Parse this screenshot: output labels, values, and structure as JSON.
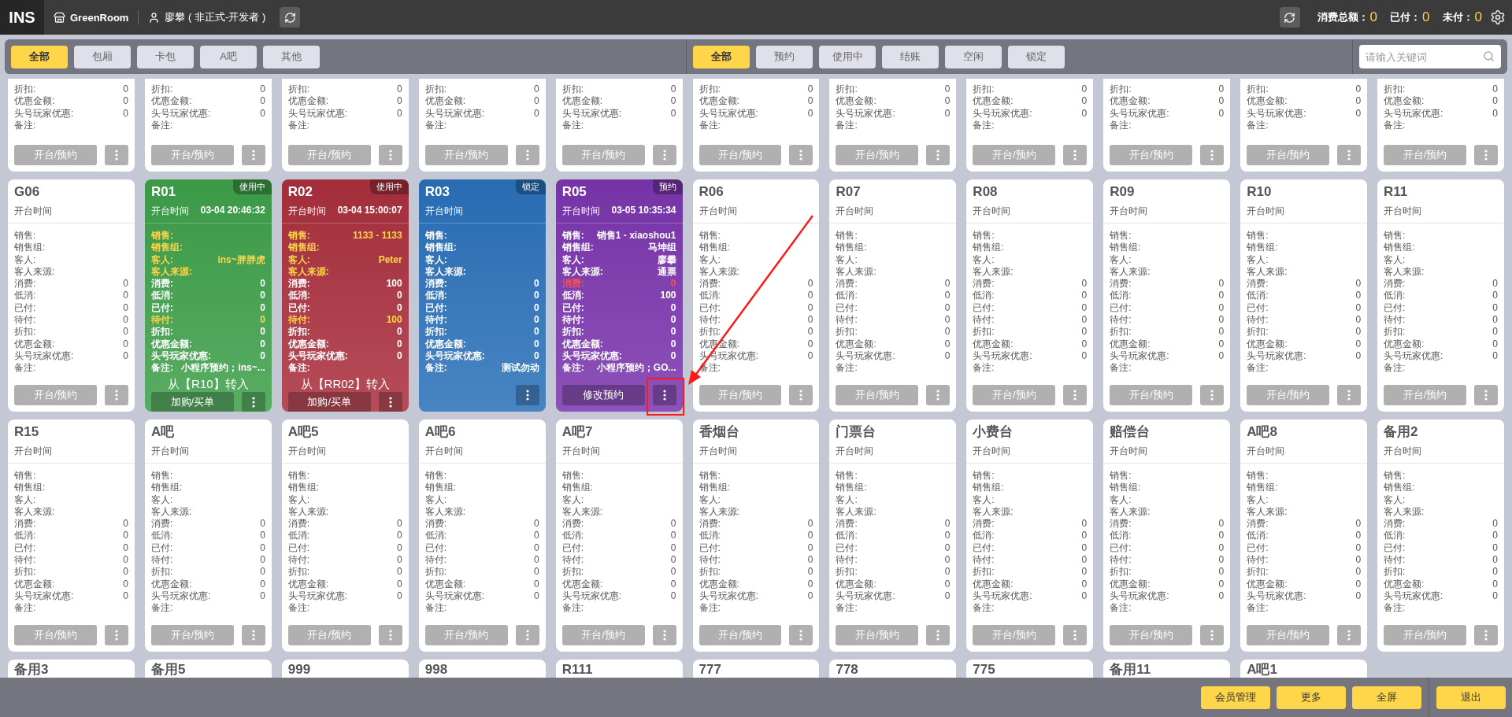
{
  "header": {
    "logo": "INS",
    "store": "GreenRoom",
    "user": "廖攀 ( 非正式-开发者 )",
    "stats": [
      {
        "label": "消费总额：",
        "value": "0"
      },
      {
        "label": "已付：",
        "value": "0"
      },
      {
        "label": "未付：",
        "value": "0"
      }
    ]
  },
  "area_tabs": [
    {
      "label": "全部",
      "selected": true
    },
    {
      "label": "包厢",
      "selected": false
    },
    {
      "label": "卡包",
      "selected": false
    },
    {
      "label": "A吧",
      "selected": false
    },
    {
      "label": "其他",
      "selected": false
    }
  ],
  "status_tabs": [
    {
      "label": "全部",
      "selected": true
    },
    {
      "label": "预约",
      "selected": false
    },
    {
      "label": "使用中",
      "selected": false
    },
    {
      "label": "结账",
      "selected": false
    },
    {
      "label": "空闲",
      "selected": false
    },
    {
      "label": "锁定",
      "selected": false
    }
  ],
  "search": {
    "placeholder": "请输入关键词"
  },
  "cards": [
    {
      "fields": [
        {
          "label": "折扣:",
          "value": "0"
        },
        {
          "label": "优惠金额:",
          "value": "0"
        },
        {
          "label": "头号玩家优惠:",
          "value": "0"
        },
        {
          "label": "备注:"
        }
      ],
      "button": "开台/预约"
    },
    {
      "fields": [
        {
          "label": "折扣:",
          "value": "0"
        },
        {
          "label": "优惠金额:",
          "value": "0"
        },
        {
          "label": "头号玩家优惠:",
          "value": "0"
        },
        {
          "label": "备注:"
        }
      ],
      "button": "开台/预约"
    },
    {
      "fields": [
        {
          "label": "折扣:",
          "value": "0"
        },
        {
          "label": "优惠金额:",
          "value": "0"
        },
        {
          "label": "头号玩家优惠:",
          "value": "0"
        },
        {
          "label": "备注:"
        }
      ],
      "button": "开台/预约"
    },
    {
      "fields": [
        {
          "label": "折扣:",
          "value": "0"
        },
        {
          "label": "优惠金额:",
          "value": "0"
        },
        {
          "label": "头号玩家优惠:",
          "value": "0"
        },
        {
          "label": "备注:"
        }
      ],
      "button": "开台/预约"
    },
    {
      "fields": [
        {
          "label": "折扣:",
          "value": "0"
        },
        {
          "label": "优惠金额:",
          "value": "0"
        },
        {
          "label": "头号玩家优惠:",
          "value": "0"
        },
        {
          "label": "备注:"
        }
      ],
      "button": "开台/预约"
    },
    {
      "fields": [
        {
          "label": "折扣:",
          "value": "0"
        },
        {
          "label": "优惠金额:",
          "value": "0"
        },
        {
          "label": "头号玩家优惠:",
          "value": "0"
        },
        {
          "label": "备注:"
        }
      ],
      "button": "开台/预约"
    },
    {
      "fields": [
        {
          "label": "折扣:",
          "value": "0"
        },
        {
          "label": "优惠金额:",
          "value": "0"
        },
        {
          "label": "头号玩家优惠:",
          "value": "0"
        },
        {
          "label": "备注:"
        }
      ],
      "button": "开台/预约"
    },
    {
      "fields": [
        {
          "label": "折扣:",
          "value": "0"
        },
        {
          "label": "优惠金额:",
          "value": "0"
        },
        {
          "label": "头号玩家优惠:",
          "value": "0"
        },
        {
          "label": "备注:"
        }
      ],
      "button": "开台/预约"
    },
    {
      "fields": [
        {
          "label": "折扣:",
          "value": "0"
        },
        {
          "label": "优惠金额:",
          "value": "0"
        },
        {
          "label": "头号玩家优惠:",
          "value": "0"
        },
        {
          "label": "备注:"
        }
      ],
      "button": "开台/预约"
    },
    {
      "fields": [
        {
          "label": "折扣:",
          "value": "0"
        },
        {
          "label": "优惠金额:",
          "value": "0"
        },
        {
          "label": "头号玩家优惠:",
          "value": "0"
        },
        {
          "label": "备注:"
        }
      ],
      "button": "开台/预约"
    },
    {
      "fields": [
        {
          "label": "折扣:",
          "value": "0"
        },
        {
          "label": "优惠金额:",
          "value": "0"
        },
        {
          "label": "头号玩家优惠:",
          "value": "0"
        },
        {
          "label": "备注:"
        }
      ],
      "button": "开台/预约"
    },
    {
      "title": "G06",
      "open_label": "开台时间",
      "fields": [
        {
          "label": "销售:"
        },
        {
          "label": "销售组:"
        },
        {
          "label": "客人:"
        },
        {
          "label": "客人来源:"
        },
        {
          "label": "消费:",
          "value": "0"
        },
        {
          "label": "低消:",
          "value": "0"
        },
        {
          "label": "已付:",
          "value": "0"
        },
        {
          "label": "待付:",
          "value": "0"
        },
        {
          "label": "折扣:",
          "value": "0"
        },
        {
          "label": "优惠金额:",
          "value": "0"
        },
        {
          "label": "头号玩家优惠:",
          "value": "0"
        },
        {
          "label": "备注:"
        }
      ],
      "button": "开台/预约"
    },
    {
      "title": "R01",
      "status": "使用中",
      "color": "#3d9f49",
      "open_label": "开台时间",
      "open_time": "03-04 20:46:32",
      "fields": [
        {
          "label": "销售:",
          "color": "#ffd54a"
        },
        {
          "label": "销售组:",
          "color": "#ffd54a"
        },
        {
          "label": "客人:",
          "value": "ins~胖胖虎",
          "color": "#ffd54a"
        },
        {
          "label": "客人来源:",
          "color": "#ffd54a"
        },
        {
          "label": "消费:",
          "value": "0"
        },
        {
          "label": "低消:",
          "value": "0"
        },
        {
          "label": "已付:",
          "value": "0"
        },
        {
          "label": "待付:",
          "value": "0",
          "color": "#ffd54a"
        },
        {
          "label": "折扣:",
          "value": "0"
        },
        {
          "label": "优惠金额:",
          "value": "0"
        },
        {
          "label": "头号玩家优惠:",
          "value": "0"
        },
        {
          "label": "备注:",
          "value": "小程序预约；ins~..."
        }
      ],
      "note": "从【R10】转入",
      "button": "加购/买单"
    },
    {
      "title": "R02",
      "status": "使用中",
      "color": "#a92f3d",
      "open_label": "开台时间",
      "open_time": "03-04 15:00:07",
      "fields": [
        {
          "label": "销售:",
          "value": "1133 - 1133",
          "color": "#ffd54a"
        },
        {
          "label": "销售组:",
          "color": "#ffd54a"
        },
        {
          "label": "客人:",
          "value": "Peter",
          "color": "#ffd54a"
        },
        {
          "label": "客人来源:",
          "color": "#ffd54a"
        },
        {
          "label": "消费:",
          "value": "100"
        },
        {
          "label": "低消:",
          "value": "0"
        },
        {
          "label": "已付:",
          "value": "0"
        },
        {
          "label": "待付:",
          "value": "100",
          "color": "#ffd54a"
        },
        {
          "label": "折扣:",
          "value": "0"
        },
        {
          "label": "优惠金额:",
          "value": "0"
        },
        {
          "label": "头号玩家优惠:",
          "value": "0"
        },
        {
          "label": "备注:"
        }
      ],
      "note": "从【RR02】转入",
      "button": "加购/买单"
    },
    {
      "title": "R03",
      "status": "锁定",
      "color": "#2a70b9",
      "open_label": "开台时间",
      "fields": [
        {
          "label": "销售:"
        },
        {
          "label": "销售组:"
        },
        {
          "label": "客人:"
        },
        {
          "label": "客人来源:"
        },
        {
          "label": "消费:",
          "value": "0"
        },
        {
          "label": "低消:",
          "value": "0"
        },
        {
          "label": "已付:",
          "value": "0"
        },
        {
          "label": "待付:",
          "value": "0"
        },
        {
          "label": "折扣:",
          "value": "0"
        },
        {
          "label": "优惠金额:",
          "value": "0"
        },
        {
          "label": "头号玩家优惠:",
          "value": "0"
        },
        {
          "label": "备注:",
          "value": "测试勿动"
        }
      ]
    },
    {
      "title": "R05",
      "status": "预约",
      "color": "#7a35ad",
      "open_label": "开台时间",
      "open_time": "03-05 10:35:34",
      "fields": [
        {
          "label": "销售:",
          "value": "销售1 - xiaoshou1"
        },
        {
          "label": "销售组:",
          "value": "马坤组"
        },
        {
          "label": "客人:",
          "value": "廖攀"
        },
        {
          "label": "客人来源:",
          "value": "通票"
        },
        {
          "label": "消费:",
          "value": "0",
          "color": "#ff4d4f"
        },
        {
          "label": "低消:",
          "value": "100"
        },
        {
          "label": "已付:",
          "value": "0"
        },
        {
          "label": "待付:",
          "value": "0"
        },
        {
          "label": "折扣:",
          "value": "0"
        },
        {
          "label": "优惠金额:",
          "value": "0"
        },
        {
          "label": "头号玩家优惠:",
          "value": "0"
        },
        {
          "label": "备注:",
          "value": "小程序预约；GO..."
        }
      ],
      "button": "修改预约"
    },
    {
      "title": "R06",
      "open_label": "开台时间",
      "fields": [
        {
          "label": "销售:"
        },
        {
          "label": "销售组:"
        },
        {
          "label": "客人:"
        },
        {
          "label": "客人来源:"
        },
        {
          "label": "消费:",
          "value": "0"
        },
        {
          "label": "低消:",
          "value": "0"
        },
        {
          "label": "已付:",
          "value": "0"
        },
        {
          "label": "待付:",
          "value": "0"
        },
        {
          "label": "折扣:",
          "value": "0"
        },
        {
          "label": "优惠金额:",
          "value": "0"
        },
        {
          "label": "头号玩家优惠:",
          "value": "0"
        },
        {
          "label": "备注:"
        }
      ],
      "button": "开台/预约"
    },
    {
      "title": "R07",
      "open_label": "开台时间",
      "fields": [
        {
          "label": "销售:"
        },
        {
          "label": "销售组:"
        },
        {
          "label": "客人:"
        },
        {
          "label": "客人来源:"
        },
        {
          "label": "消费:",
          "value": "0"
        },
        {
          "label": "低消:",
          "value": "0"
        },
        {
          "label": "已付:",
          "value": "0"
        },
        {
          "label": "待付:",
          "value": "0"
        },
        {
          "label": "折扣:",
          "value": "0"
        },
        {
          "label": "优惠金额:",
          "value": "0"
        },
        {
          "label": "头号玩家优惠:",
          "value": "0"
        },
        {
          "label": "备注:"
        }
      ],
      "button": "开台/预约"
    },
    {
      "title": "R08",
      "open_label": "开台时间",
      "fields": [
        {
          "label": "销售:"
        },
        {
          "label": "销售组:"
        },
        {
          "label": "客人:"
        },
        {
          "label": "客人来源:"
        },
        {
          "label": "消费:",
          "value": "0"
        },
        {
          "label": "低消:",
          "value": "0"
        },
        {
          "label": "已付:",
          "value": "0"
        },
        {
          "label": "待付:",
          "value": "0"
        },
        {
          "label": "折扣:",
          "value": "0"
        },
        {
          "label": "优惠金额:",
          "value": "0"
        },
        {
          "label": "头号玩家优惠:",
          "value": "0"
        },
        {
          "label": "备注:"
        }
      ],
      "button": "开台/预约"
    },
    {
      "title": "R09",
      "open_label": "开台时间",
      "fields": [
        {
          "label": "销售:"
        },
        {
          "label": "销售组:"
        },
        {
          "label": "客人:"
        },
        {
          "label": "客人来源:"
        },
        {
          "label": "消费:",
          "value": "0"
        },
        {
          "label": "低消:",
          "value": "0"
        },
        {
          "label": "已付:",
          "value": "0"
        },
        {
          "label": "待付:",
          "value": "0"
        },
        {
          "label": "折扣:",
          "value": "0"
        },
        {
          "label": "优惠金额:",
          "value": "0"
        },
        {
          "label": "头号玩家优惠:",
          "value": "0"
        },
        {
          "label": "备注:"
        }
      ],
      "button": "开台/预约"
    },
    {
      "title": "R10",
      "open_label": "开台时间",
      "fields": [
        {
          "label": "销售:"
        },
        {
          "label": "销售组:"
        },
        {
          "label": "客人:"
        },
        {
          "label": "客人来源:"
        },
        {
          "label": "消费:",
          "value": "0"
        },
        {
          "label": "低消:",
          "value": "0"
        },
        {
          "label": "已付:",
          "value": "0"
        },
        {
          "label": "待付:",
          "value": "0"
        },
        {
          "label": "折扣:",
          "value": "0"
        },
        {
          "label": "优惠金额:",
          "value": "0"
        },
        {
          "label": "头号玩家优惠:",
          "value": "0"
        },
        {
          "label": "备注:"
        }
      ],
      "button": "开台/预约"
    },
    {
      "title": "R11",
      "open_label": "开台时间",
      "fields": [
        {
          "label": "销售:"
        },
        {
          "label": "销售组:"
        },
        {
          "label": "客人:"
        },
        {
          "label": "客人来源:"
        },
        {
          "label": "消费:",
          "value": "0"
        },
        {
          "label": "低消:",
          "value": "0"
        },
        {
          "label": "已付:",
          "value": "0"
        },
        {
          "label": "待付:",
          "value": "0"
        },
        {
          "label": "折扣:",
          "value": "0"
        },
        {
          "label": "优惠金额:",
          "value": "0"
        },
        {
          "label": "头号玩家优惠:",
          "value": "0"
        },
        {
          "label": "备注:"
        }
      ],
      "button": "开台/预约"
    },
    {
      "title": "R15",
      "open_label": "开台时间",
      "fields": [
        {
          "label": "销售:"
        },
        {
          "label": "销售组:"
        },
        {
          "label": "客人:"
        },
        {
          "label": "客人来源:"
        },
        {
          "label": "消费:",
          "value": "0"
        },
        {
          "label": "低消:",
          "value": "0"
        },
        {
          "label": "已付:",
          "value": "0"
        },
        {
          "label": "待付:",
          "value": "0"
        },
        {
          "label": "折扣:",
          "value": "0"
        },
        {
          "label": "优惠金额:",
          "value": "0"
        },
        {
          "label": "头号玩家优惠:",
          "value": "0"
        },
        {
          "label": "备注:"
        }
      ],
      "button": "开台/预约"
    },
    {
      "title": "A吧",
      "open_label": "开台时间",
      "fields": [
        {
          "label": "销售:"
        },
        {
          "label": "销售组:"
        },
        {
          "label": "客人:"
        },
        {
          "label": "客人来源:"
        },
        {
          "label": "消费:",
          "value": "0"
        },
        {
          "label": "低消:",
          "value": "0"
        },
        {
          "label": "已付:",
          "value": "0"
        },
        {
          "label": "待付:",
          "value": "0"
        },
        {
          "label": "折扣:",
          "value": "0"
        },
        {
          "label": "优惠金额:",
          "value": "0"
        },
        {
          "label": "头号玩家优惠:",
          "value": "0"
        },
        {
          "label": "备注:"
        }
      ],
      "button": "开台/预约"
    },
    {
      "title": "A吧5",
      "open_label": "开台时间",
      "fields": [
        {
          "label": "销售:"
        },
        {
          "label": "销售组:"
        },
        {
          "label": "客人:"
        },
        {
          "label": "客人来源:"
        },
        {
          "label": "消费:",
          "value": "0"
        },
        {
          "label": "低消:",
          "value": "0"
        },
        {
          "label": "已付:",
          "value": "0"
        },
        {
          "label": "待付:",
          "value": "0"
        },
        {
          "label": "折扣:",
          "value": "0"
        },
        {
          "label": "优惠金额:",
          "value": "0"
        },
        {
          "label": "头号玩家优惠:",
          "value": "0"
        },
        {
          "label": "备注:"
        }
      ],
      "button": "开台/预约"
    },
    {
      "title": "A吧6",
      "open_label": "开台时间",
      "fields": [
        {
          "label": "销售:"
        },
        {
          "label": "销售组:"
        },
        {
          "label": "客人:"
        },
        {
          "label": "客人来源:"
        },
        {
          "label": "消费:",
          "value": "0"
        },
        {
          "label": "低消:",
          "value": "0"
        },
        {
          "label": "已付:",
          "value": "0"
        },
        {
          "label": "待付:",
          "value": "0"
        },
        {
          "label": "折扣:",
          "value": "0"
        },
        {
          "label": "优惠金额:",
          "value": "0"
        },
        {
          "label": "头号玩家优惠:",
          "value": "0"
        },
        {
          "label": "备注:"
        }
      ],
      "button": "开台/预约"
    },
    {
      "title": "A吧7",
      "open_label": "开台时间",
      "fields": [
        {
          "label": "销售:"
        },
        {
          "label": "销售组:"
        },
        {
          "label": "客人:"
        },
        {
          "label": "客人来源:"
        },
        {
          "label": "消费:",
          "value": "0"
        },
        {
          "label": "低消:",
          "value": "0"
        },
        {
          "label": "已付:",
          "value": "0"
        },
        {
          "label": "待付:",
          "value": "0"
        },
        {
          "label": "折扣:",
          "value": "0"
        },
        {
          "label": "优惠金额:",
          "value": "0"
        },
        {
          "label": "头号玩家优惠:",
          "value": "0"
        },
        {
          "label": "备注:"
        }
      ],
      "button": "开台/预约"
    },
    {
      "title": "香烟台",
      "open_label": "开台时间",
      "fields": [
        {
          "label": "销售:"
        },
        {
          "label": "销售组:"
        },
        {
          "label": "客人:"
        },
        {
          "label": "客人来源:"
        },
        {
          "label": "消费:",
          "value": "0"
        },
        {
          "label": "低消:",
          "value": "0"
        },
        {
          "label": "已付:",
          "value": "0"
        },
        {
          "label": "待付:",
          "value": "0"
        },
        {
          "label": "折扣:",
          "value": "0"
        },
        {
          "label": "优惠金额:",
          "value": "0"
        },
        {
          "label": "头号玩家优惠:",
          "value": "0"
        },
        {
          "label": "备注:"
        }
      ],
      "button": "开台/预约"
    },
    {
      "title": "门票台",
      "open_label": "开台时间",
      "fields": [
        {
          "label": "销售:"
        },
        {
          "label": "销售组:"
        },
        {
          "label": "客人:"
        },
        {
          "label": "客人来源:"
        },
        {
          "label": "消费:",
          "value": "0"
        },
        {
          "label": "低消:",
          "value": "0"
        },
        {
          "label": "已付:",
          "value": "0"
        },
        {
          "label": "待付:",
          "value": "0"
        },
        {
          "label": "折扣:",
          "value": "0"
        },
        {
          "label": "优惠金额:",
          "value": "0"
        },
        {
          "label": "头号玩家优惠:",
          "value": "0"
        },
        {
          "label": "备注:"
        }
      ],
      "button": "开台/预约"
    },
    {
      "title": "小费台",
      "open_label": "开台时间",
      "fields": [
        {
          "label": "销售:"
        },
        {
          "label": "销售组:"
        },
        {
          "label": "客人:"
        },
        {
          "label": "客人来源:"
        },
        {
          "label": "消费:",
          "value": "0"
        },
        {
          "label": "低消:",
          "value": "0"
        },
        {
          "label": "已付:",
          "value": "0"
        },
        {
          "label": "待付:",
          "value": "0"
        },
        {
          "label": "折扣:",
          "value": "0"
        },
        {
          "label": "优惠金额:",
          "value": "0"
        },
        {
          "label": "头号玩家优惠:",
          "value": "0"
        },
        {
          "label": "备注:"
        }
      ],
      "button": "开台/预约"
    },
    {
      "title": "赔偿台",
      "open_label": "开台时间",
      "fields": [
        {
          "label": "销售:"
        },
        {
          "label": "销售组:"
        },
        {
          "label": "客人:"
        },
        {
          "label": "客人来源:"
        },
        {
          "label": "消费:",
          "value": "0"
        },
        {
          "label": "低消:",
          "value": "0"
        },
        {
          "label": "已付:",
          "value": "0"
        },
        {
          "label": "待付:",
          "value": "0"
        },
        {
          "label": "折扣:",
          "value": "0"
        },
        {
          "label": "优惠金额:",
          "value": "0"
        },
        {
          "label": "头号玩家优惠:",
          "value": "0"
        },
        {
          "label": "备注:"
        }
      ],
      "button": "开台/预约"
    },
    {
      "title": "A吧8",
      "open_label": "开台时间",
      "fields": [
        {
          "label": "销售:"
        },
        {
          "label": "销售组:"
        },
        {
          "label": "客人:"
        },
        {
          "label": "客人来源:"
        },
        {
          "label": "消费:",
          "value": "0"
        },
        {
          "label": "低消:",
          "value": "0"
        },
        {
          "label": "已付:",
          "value": "0"
        },
        {
          "label": "待付:",
          "value": "0"
        },
        {
          "label": "折扣:",
          "value": "0"
        },
        {
          "label": "优惠金额:",
          "value": "0"
        },
        {
          "label": "头号玩家优惠:",
          "value": "0"
        },
        {
          "label": "备注:"
        }
      ],
      "button": "开台/预约"
    },
    {
      "title": "备用2",
      "open_label": "开台时间",
      "fields": [
        {
          "label": "销售:"
        },
        {
          "label": "销售组:"
        },
        {
          "label": "客人:"
        },
        {
          "label": "客人来源:"
        },
        {
          "label": "消费:",
          "value": "0"
        },
        {
          "label": "低消:",
          "value": "0"
        },
        {
          "label": "已付:",
          "value": "0"
        },
        {
          "label": "待付:",
          "value": "0"
        },
        {
          "label": "折扣:",
          "value": "0"
        },
        {
          "label": "优惠金额:",
          "value": "0"
        },
        {
          "label": "头号玩家优惠:",
          "value": "0"
        },
        {
          "label": "备注:"
        }
      ],
      "button": "开台/预约"
    },
    {
      "title": "备用3"
    },
    {
      "title": "备用5"
    },
    {
      "title": "999"
    },
    {
      "title": "998"
    },
    {
      "title": "R111"
    },
    {
      "title": "777"
    },
    {
      "title": "778"
    },
    {
      "title": "775"
    },
    {
      "title": "备用11"
    },
    {
      "title": "A吧1"
    }
  ],
  "footer_buttons": [
    "会员管理",
    "更多",
    "全屏"
  ],
  "exit_button": "退出"
}
